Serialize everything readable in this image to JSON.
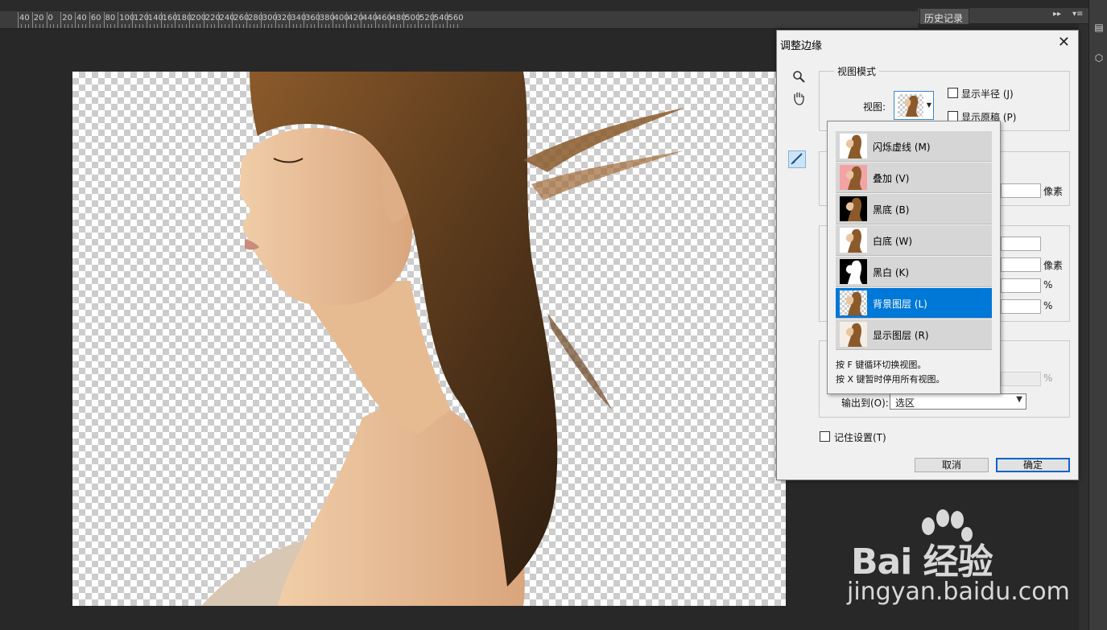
{
  "ruler": {
    "labels": [
      "40",
      "20",
      "0",
      "20",
      "40",
      "60",
      "80",
      "100",
      "120",
      "140",
      "160",
      "180",
      "200",
      "220",
      "240",
      "260",
      "280",
      "300",
      "320",
      "340",
      "360",
      "380",
      "400",
      "420",
      "440",
      "460",
      "480",
      "500",
      "520",
      "540",
      "560"
    ]
  },
  "history_panel": {
    "tab_label": "历史记录",
    "collapse_glyph": "▸▸",
    "menu_glyph": "▾≡"
  },
  "dialog": {
    "title": "调整边缘",
    "close_glyph": "✕",
    "tools": {
      "zoom": "zoom-tool",
      "hand": "hand-tool",
      "refine_brush": "refine-radius-tool"
    },
    "view_mode": {
      "group_label": "视图模式",
      "view_label": "视图:",
      "show_radius_label": "显示半径 (J)",
      "show_radius_checked": false,
      "show_original_label": "显示原稿 (P)",
      "show_original_checked": false
    },
    "units": {
      "pixels_1": "像素",
      "pixels_2": "像素",
      "percent_1": "%",
      "percent_2": "%",
      "percent_3": "%"
    },
    "output": {
      "label": "输出到(O):",
      "value": "选区"
    },
    "remember": {
      "label": "记住设置(T)",
      "checked": false
    },
    "buttons": {
      "cancel": "取消",
      "ok": "确定"
    }
  },
  "view_menu": {
    "items": [
      {
        "label": "闪烁虚线 (M)",
        "thumb": "marching-ants",
        "selected": false
      },
      {
        "label": "叠加 (V)",
        "thumb": "overlay",
        "selected": false
      },
      {
        "label": "黑底 (B)",
        "thumb": "on-black",
        "selected": false
      },
      {
        "label": "白底 (W)",
        "thumb": "on-white",
        "selected": false
      },
      {
        "label": "黑白 (K)",
        "thumb": "black-white",
        "selected": false
      },
      {
        "label": "背景图层 (L)",
        "thumb": "on-layers",
        "selected": true
      },
      {
        "label": "显示图层 (R)",
        "thumb": "reveal-layer",
        "selected": false
      }
    ],
    "hints": [
      "按 F 键循环切换视图。",
      "按 X 键暂时停用所有视图。"
    ]
  },
  "watermark": {
    "brand": "Bai 经验",
    "url": "jingyan.baidu.com"
  },
  "colors": {
    "app_bg": "#282828",
    "selection": "#0078d7",
    "ok_border": "#0a64c8"
  }
}
